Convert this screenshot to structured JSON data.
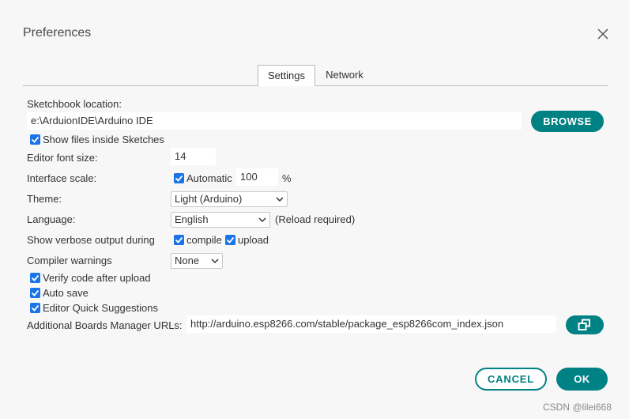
{
  "dialog": {
    "title": "Preferences"
  },
  "tabs": [
    {
      "label": "Settings",
      "active": true
    },
    {
      "label": "Network",
      "active": false
    }
  ],
  "sketchbook": {
    "label": "Sketchbook location:",
    "value": "e:\\ArduionIDE\\Arduino IDE",
    "browse_label": "BROWSE",
    "show_files_label": "Show files inside Sketches",
    "show_files_checked": true
  },
  "font_size": {
    "label": "Editor font size:",
    "value": "14"
  },
  "interface_scale": {
    "label": "Interface scale:",
    "automatic_label": "Automatic",
    "automatic_checked": true,
    "value": "100",
    "unit": "%"
  },
  "theme": {
    "label": "Theme:",
    "selected": "Light (Arduino)"
  },
  "language": {
    "label": "Language:",
    "selected": "English",
    "note": "(Reload required)"
  },
  "verbose": {
    "label": "Show verbose output during",
    "compile_label": "compile",
    "compile_checked": true,
    "upload_label": "upload",
    "upload_checked": true
  },
  "compiler_warnings": {
    "label": "Compiler warnings",
    "selected": "None"
  },
  "options": [
    {
      "label": "Verify code after upload",
      "checked": true
    },
    {
      "label": "Auto save",
      "checked": true
    },
    {
      "label": "Editor Quick Suggestions",
      "checked": true
    }
  ],
  "boards_urls": {
    "label": "Additional Boards Manager URLs:",
    "value": "http://arduino.esp8266.com/stable/package_esp8266com_index.json"
  },
  "footer": {
    "cancel_label": "CANCEL",
    "ok_label": "OK"
  },
  "watermark": "CSDN @lilei668",
  "colors": {
    "accent": "#008184",
    "checkbox": "#1a73e8",
    "background": "#f7f7f7"
  }
}
